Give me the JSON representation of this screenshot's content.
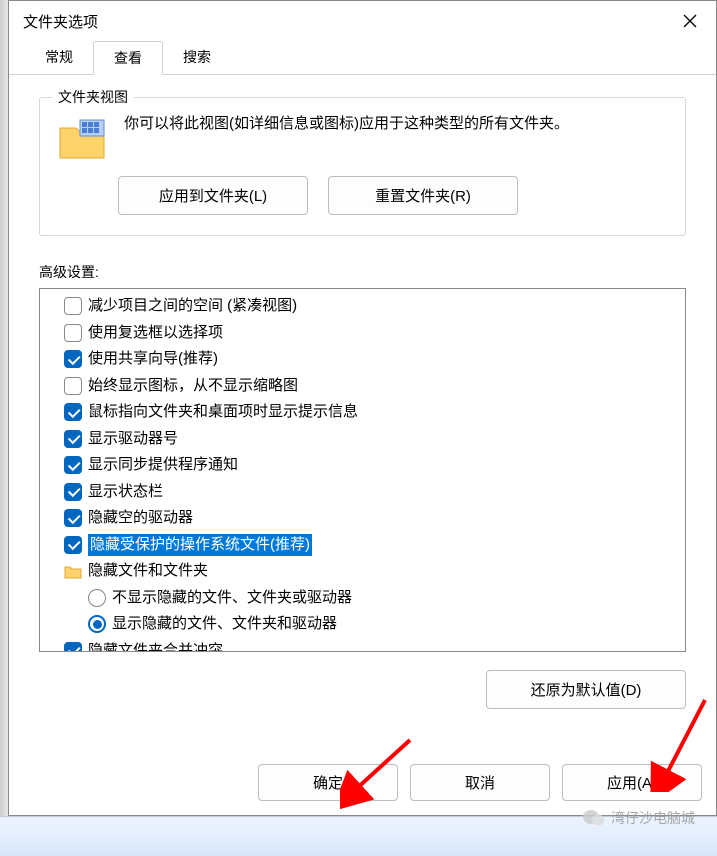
{
  "window": {
    "title": "文件夹选项"
  },
  "tabs": {
    "general": "常规",
    "view": "查看",
    "search": "搜索"
  },
  "folderview": {
    "legend": "文件夹视图",
    "desc": "你可以将此视图(如详细信息或图标)应用于这种类型的所有文件夹。",
    "apply_btn": "应用到文件夹(L)",
    "reset_btn": "重置文件夹(R)"
  },
  "advanced": {
    "label": "高级设置:",
    "items": [
      {
        "type": "checkbox",
        "checked": false,
        "indent": 1,
        "label": "减少项目之间的空间 (紧凑视图)"
      },
      {
        "type": "checkbox",
        "checked": false,
        "indent": 1,
        "label": "使用复选框以选择项"
      },
      {
        "type": "checkbox",
        "checked": true,
        "indent": 1,
        "label": "使用共享向导(推荐)"
      },
      {
        "type": "checkbox",
        "checked": false,
        "indent": 1,
        "label": "始终显示图标，从不显示缩略图"
      },
      {
        "type": "checkbox",
        "checked": true,
        "indent": 1,
        "label": "鼠标指向文件夹和桌面项时显示提示信息"
      },
      {
        "type": "checkbox",
        "checked": true,
        "indent": 1,
        "label": "显示驱动器号"
      },
      {
        "type": "checkbox",
        "checked": true,
        "indent": 1,
        "label": "显示同步提供程序通知"
      },
      {
        "type": "checkbox",
        "checked": true,
        "indent": 1,
        "label": "显示状态栏"
      },
      {
        "type": "checkbox",
        "checked": true,
        "indent": 1,
        "label": "隐藏空的驱动器"
      },
      {
        "type": "checkbox",
        "checked": true,
        "indent": 1,
        "label": "隐藏受保护的操作系统文件(推荐)",
        "selected": true
      },
      {
        "type": "folder",
        "indent": 1,
        "label": "隐藏文件和文件夹"
      },
      {
        "type": "radio",
        "checked": false,
        "indent": 2,
        "label": "不显示隐藏的文件、文件夹或驱动器"
      },
      {
        "type": "radio",
        "checked": true,
        "indent": 2,
        "label": "显示隐藏的文件、文件夹和驱动器"
      },
      {
        "type": "checkbox",
        "checked": true,
        "indent": 1,
        "label": "隐藏文件夹合并冲突"
      }
    ],
    "restore_btn": "还原为默认值(D)"
  },
  "footer": {
    "ok": "确定",
    "cancel": "取消",
    "apply": "应用(A)"
  },
  "watermark": {
    "text": "湾仔沙电脑城"
  }
}
